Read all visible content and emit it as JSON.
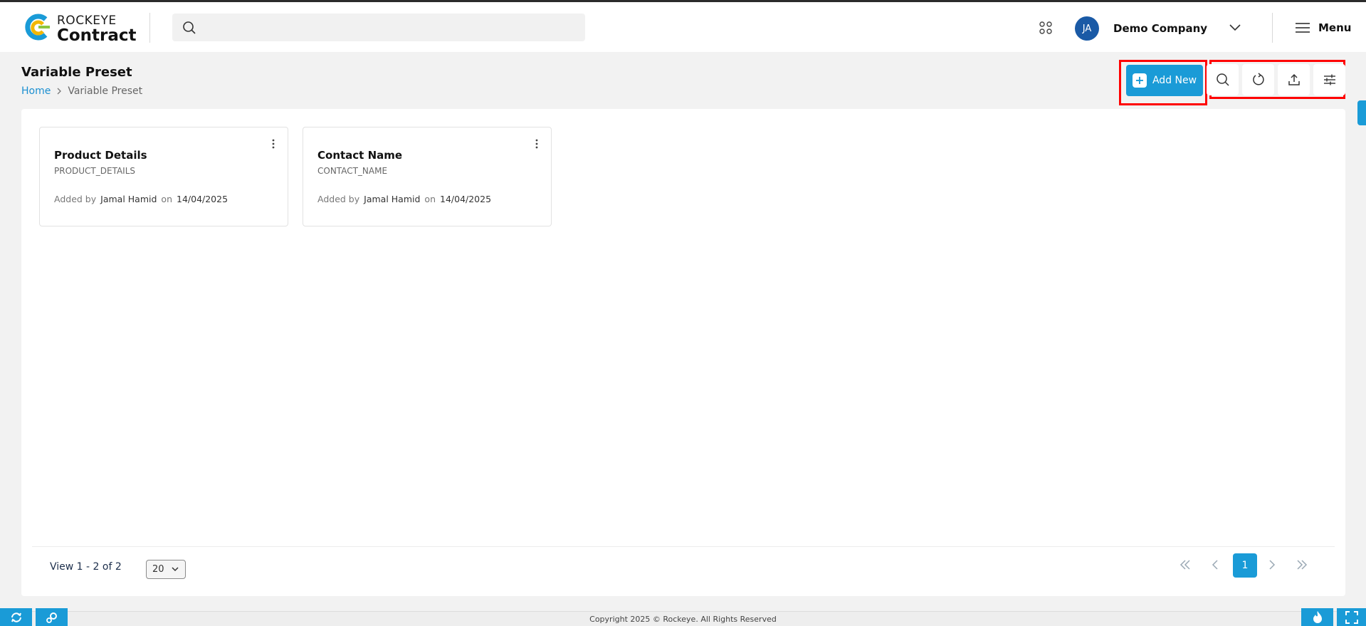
{
  "header": {
    "brand_top": "ROCKEYE",
    "brand_bottom": "Contract",
    "search_placeholder": "",
    "avatar_initials": "JA",
    "company_name": "Demo Company",
    "menu_label": "Menu",
    "icons": [
      "search-icon",
      "apps-grid-icon",
      "chevron-down-icon",
      "hamburger-icon"
    ]
  },
  "page": {
    "title": "Variable Preset",
    "breadcrumb": {
      "home": "Home",
      "current": "Variable Preset"
    }
  },
  "toolbar": {
    "add_label": "Add New",
    "add_icon": "+",
    "tools": [
      "search-icon",
      "refresh-icon",
      "upload-icon",
      "filter-sliders-icon"
    ]
  },
  "cards": [
    {
      "title": "Product Details",
      "key": "PRODUCT_DETAILS",
      "added_by_label": "Added by",
      "author": "Jamal Hamid",
      "on_label": "on",
      "date": "14/04/2025"
    },
    {
      "title": "Contact Name",
      "key": "CONTACT_NAME",
      "added_by_label": "Added by",
      "author": "Jamal Hamid",
      "on_label": "on",
      "date": "14/04/2025"
    }
  ],
  "pagination": {
    "view_text": "View 1 - 2 of 2",
    "page_size": "20",
    "current_page": "1"
  },
  "footer": {
    "copyright": "Copyright 2025 © Rockeye. All Rights Reserved"
  },
  "colors": {
    "accent": "#1a9bd7",
    "avatar": "#1a5aa6",
    "highlight": "#ff0000"
  }
}
